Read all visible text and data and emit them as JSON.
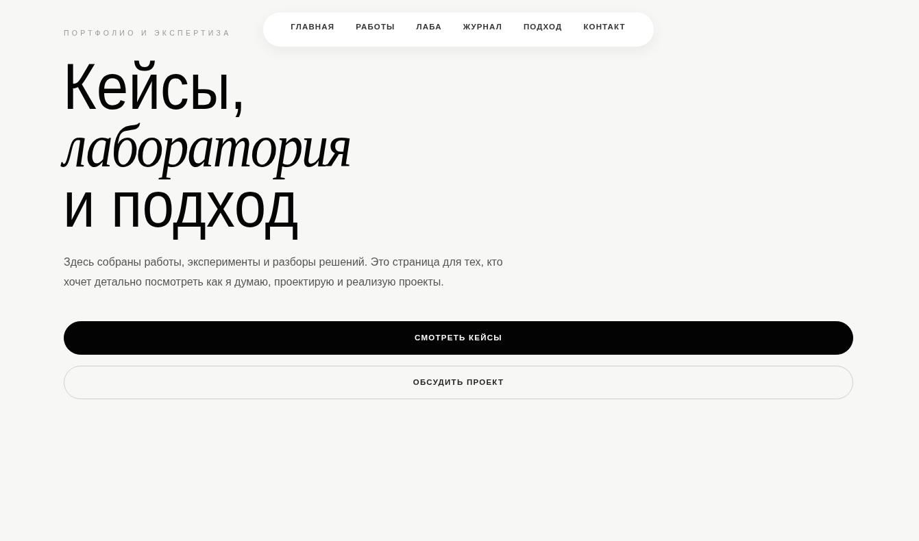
{
  "eyebrow": "ПОРТФОЛИО И ЭКСПЕРТИЗА",
  "nav": {
    "items": [
      "ГЛАВНАЯ",
      "РАБОТЫ",
      "ЛАБА",
      "ЖУРНАЛ",
      "ПОДХОД",
      "КОНТАКТ"
    ]
  },
  "heading": "Кейсы, *лаборатория* и подход",
  "intro": "Здесь собраны работы, эксперименты и разборы решений. Это страница для тех, кто хочет детально посмотреть как я думаю, проектирую и реализую проекты.",
  "buttons": [
    {
      "label": "СМОТРЕТЬ КЕЙСЫ",
      "kind": "primary"
    },
    {
      "label": "ОБСУДИТЬ ПРОЕКТ",
      "kind": "outline"
    }
  ]
}
